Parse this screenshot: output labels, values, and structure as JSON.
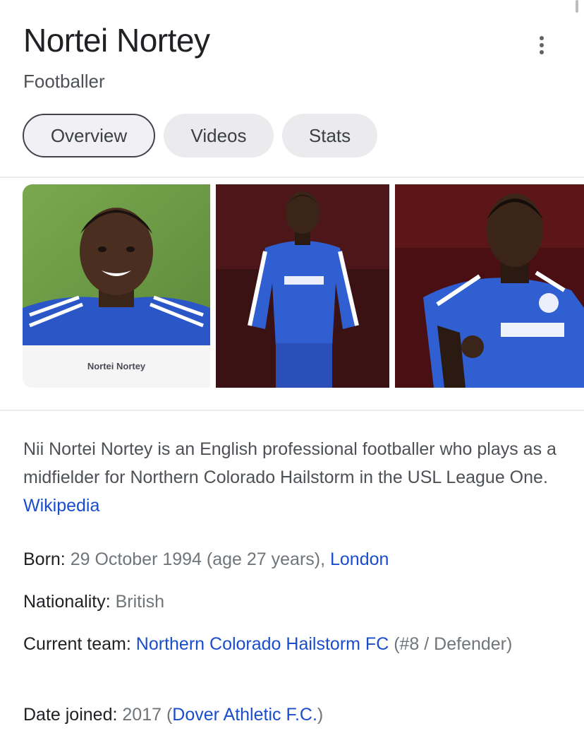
{
  "header": {
    "title": "Nortei Nortey",
    "subtitle": "Footballer"
  },
  "tabs": [
    {
      "label": "Overview",
      "active": true
    },
    {
      "label": "Videos",
      "active": false
    },
    {
      "label": "Stats",
      "active": false
    }
  ],
  "images": {
    "first_caption": "Nortei Nortey"
  },
  "description": {
    "text": "Nii Nortei Nortey is an English professional footballer who plays as a midfielder for Northern Colorado Hailstorm in the USL League One. ",
    "source_link": "Wikipedia"
  },
  "facts": {
    "born": {
      "label": "Born:",
      "value": " 29 October 1994 (age 27 years), ",
      "link": "London"
    },
    "nationality": {
      "label": "Nationality:",
      "value": " British"
    },
    "current_team": {
      "label": "Current team:",
      "pre": " ",
      "link": "Northern Colorado Hailstorm FC",
      "value": " (#8 / Defender)"
    },
    "date_joined": {
      "label": "Date joined:",
      "value": " 2017 (",
      "link": "Dover Athletic F.C.",
      "post": ")"
    }
  },
  "colors": {
    "link": "#1a4dcc",
    "kit_blue": "#2f5fd0",
    "active_tab_border": "#45424e"
  },
  "icons": {
    "more": "more-vert-icon"
  }
}
